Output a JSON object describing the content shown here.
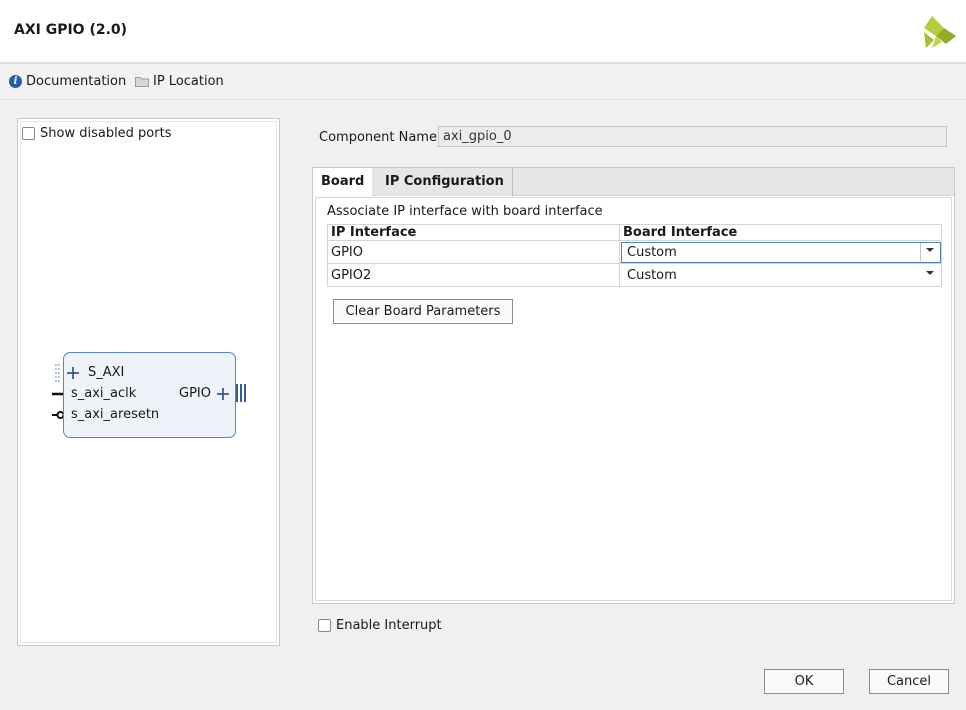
{
  "window": {
    "title": "AXI GPIO (2.0)"
  },
  "links": {
    "documentation": "Documentation",
    "ip_location": "IP Location"
  },
  "left_panel": {
    "show_disabled_ports": "Show disabled ports",
    "block": {
      "s_axi": "S_AXI",
      "s_axi_aclk": "s_axi_aclk",
      "s_axi_aresetn": "s_axi_aresetn",
      "gpio": "GPIO"
    }
  },
  "component": {
    "label": "Component Name",
    "value": "axi_gpio_0"
  },
  "tabs": [
    {
      "label": "Board"
    },
    {
      "label": "IP Configuration"
    }
  ],
  "board_tab": {
    "description": "Associate IP interface with board interface",
    "columns": [
      "IP Interface",
      "Board Interface"
    ],
    "rows": [
      {
        "ip_interface": "GPIO",
        "board_interface": "Custom"
      },
      {
        "ip_interface": "GPIO2",
        "board_interface": "Custom"
      }
    ],
    "clear_button": "Clear Board Parameters"
  },
  "enable_interrupt": "Enable Interrupt",
  "buttons": {
    "ok": "OK",
    "cancel": "Cancel"
  },
  "colors": {
    "accent": "#4a7fc1",
    "block_fill": "#eef3f9",
    "block_border": "#5b86c0",
    "logo": "#9bbb2e"
  }
}
